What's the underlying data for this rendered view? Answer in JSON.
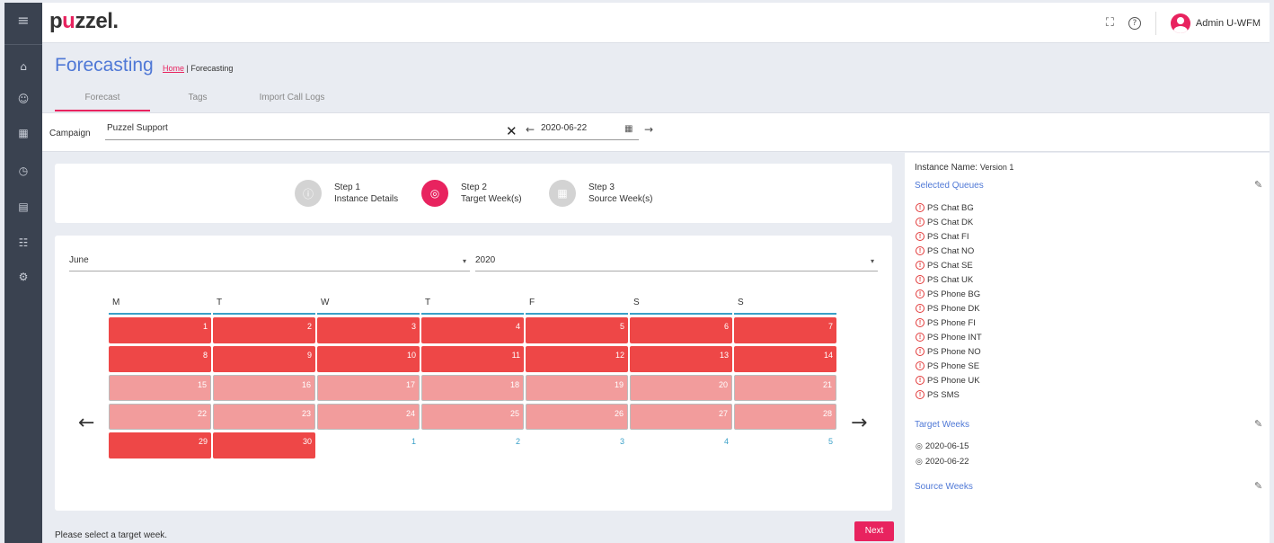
{
  "rail": {
    "menu_icon": "≡",
    "items": [
      {
        "icon": "home-icon",
        "glyph": "⌂"
      },
      {
        "icon": "users-icon",
        "glyph": "☺"
      },
      {
        "icon": "calendar-icon",
        "glyph": "▦"
      },
      {
        "icon": "clock-icon",
        "glyph": "◷"
      },
      {
        "icon": "document-icon",
        "glyph": "▤"
      },
      {
        "icon": "team-icon",
        "glyph": "☷"
      },
      {
        "icon": "settings-icon",
        "glyph": "⚙"
      }
    ]
  },
  "topbar": {
    "logo_p": "p",
    "logo_u": "u",
    "logo_rest": "zzel.",
    "fullscreen_icon": "⛶",
    "help_icon": "?",
    "user_name": "Admin U-WFM"
  },
  "header": {
    "title": "Forecasting",
    "breadcrumb_home": "Home",
    "breadcrumb_sep": "|",
    "breadcrumb_current": "Forecasting",
    "tabs": [
      {
        "label": "Forecast",
        "active": true
      },
      {
        "label": "Tags",
        "active": false
      },
      {
        "label": "Import Call Logs",
        "active": false
      }
    ]
  },
  "campaign": {
    "label": "Campaign",
    "value": "Puzzel Support",
    "clear_icon": "✕",
    "prev_icon": "←",
    "date": "2020-06-22",
    "calendar_icon": "▦",
    "next_icon": "→"
  },
  "stepper": {
    "steps": [
      {
        "title": "Step 1",
        "subtitle": "Instance Details",
        "glyph": "ⓘ",
        "active": false
      },
      {
        "title": "Step 2",
        "subtitle": "Target Week(s)",
        "glyph": "◎",
        "active": true
      },
      {
        "title": "Step 3",
        "subtitle": "Source Week(s)",
        "glyph": "▦",
        "active": false
      }
    ]
  },
  "calendar": {
    "month": "June",
    "year": "2020",
    "caret": "▾",
    "prev_arrow": "←",
    "next_arrow": "→",
    "weekdays": [
      "M",
      "T",
      "W",
      "T",
      "F",
      "S",
      "S"
    ],
    "weeks": [
      [
        {
          "d": "1",
          "s": "sel"
        },
        {
          "d": "2",
          "s": "sel"
        },
        {
          "d": "3",
          "s": "sel"
        },
        {
          "d": "4",
          "s": "sel"
        },
        {
          "d": "5",
          "s": "sel"
        },
        {
          "d": "6",
          "s": "sel"
        },
        {
          "d": "7",
          "s": "sel"
        }
      ],
      [
        {
          "d": "8",
          "s": "sel"
        },
        {
          "d": "9",
          "s": "sel"
        },
        {
          "d": "10",
          "s": "sel"
        },
        {
          "d": "11",
          "s": "sel"
        },
        {
          "d": "12",
          "s": "sel"
        },
        {
          "d": "13",
          "s": "sel"
        },
        {
          "d": "14",
          "s": "sel"
        }
      ],
      [
        {
          "d": "15",
          "s": "avail"
        },
        {
          "d": "16",
          "s": "avail"
        },
        {
          "d": "17",
          "s": "avail"
        },
        {
          "d": "18",
          "s": "avail"
        },
        {
          "d": "19",
          "s": "avail"
        },
        {
          "d": "20",
          "s": "avail"
        },
        {
          "d": "21",
          "s": "avail"
        }
      ],
      [
        {
          "d": "22",
          "s": "avail"
        },
        {
          "d": "23",
          "s": "avail"
        },
        {
          "d": "24",
          "s": "avail"
        },
        {
          "d": "25",
          "s": "avail"
        },
        {
          "d": "26",
          "s": "avail"
        },
        {
          "d": "27",
          "s": "avail"
        },
        {
          "d": "28",
          "s": "avail"
        }
      ],
      [
        {
          "d": "29",
          "s": "sel"
        },
        {
          "d": "30",
          "s": "sel"
        },
        {
          "d": "1",
          "s": "next-month"
        },
        {
          "d": "2",
          "s": "next-month"
        },
        {
          "d": "3",
          "s": "next-month"
        },
        {
          "d": "4",
          "s": "next-month"
        },
        {
          "d": "5",
          "s": "next-month"
        }
      ]
    ]
  },
  "footer": {
    "hint": "Please select a target week.",
    "next_label": "Next"
  },
  "side": {
    "instance_label": "Instance Name:",
    "instance_value": "Version 1",
    "selected_queues_title": "Selected Queues",
    "edit_icon": "✎",
    "queue_icon": "!",
    "queues": [
      "PS Chat BG",
      "PS Chat DK",
      "PS Chat FI",
      "PS Chat NO",
      "PS Chat SE",
      "PS Chat UK",
      "PS Phone BG",
      "PS Phone DK",
      "PS Phone FI",
      "PS Phone INT",
      "PS Phone NO",
      "PS Phone SE",
      "PS Phone UK",
      "PS SMS"
    ],
    "target_weeks_title": "Target Weeks",
    "target_icon": "◎",
    "target_weeks": [
      "2020-06-15",
      "2020-06-22"
    ],
    "source_weeks_title": "Source Weeks"
  },
  "colors": {
    "brand": "#e8235f",
    "link_blue": "#4f78d6",
    "selected_day": "#ee4747",
    "available_day": "#f29c9c",
    "weekday_underline": "#3aa0c8"
  }
}
